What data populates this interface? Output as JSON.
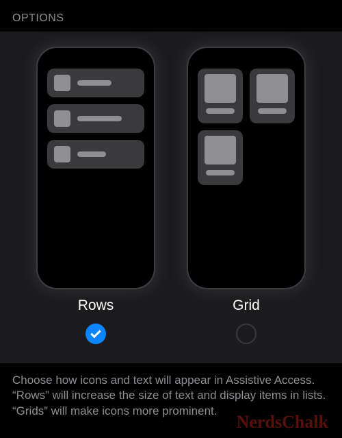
{
  "header": {
    "title": "OPTIONS"
  },
  "options": {
    "rows": {
      "label": "Rows",
      "selected": true
    },
    "grid": {
      "label": "Grid",
      "selected": false
    }
  },
  "footer": {
    "description": "Choose how icons and text will appear in Assistive Access. “Rows” will increase the size of text and display items in lists. “Grids” will make icons more prominent."
  },
  "watermark": {
    "text": "NerdsChalk"
  }
}
